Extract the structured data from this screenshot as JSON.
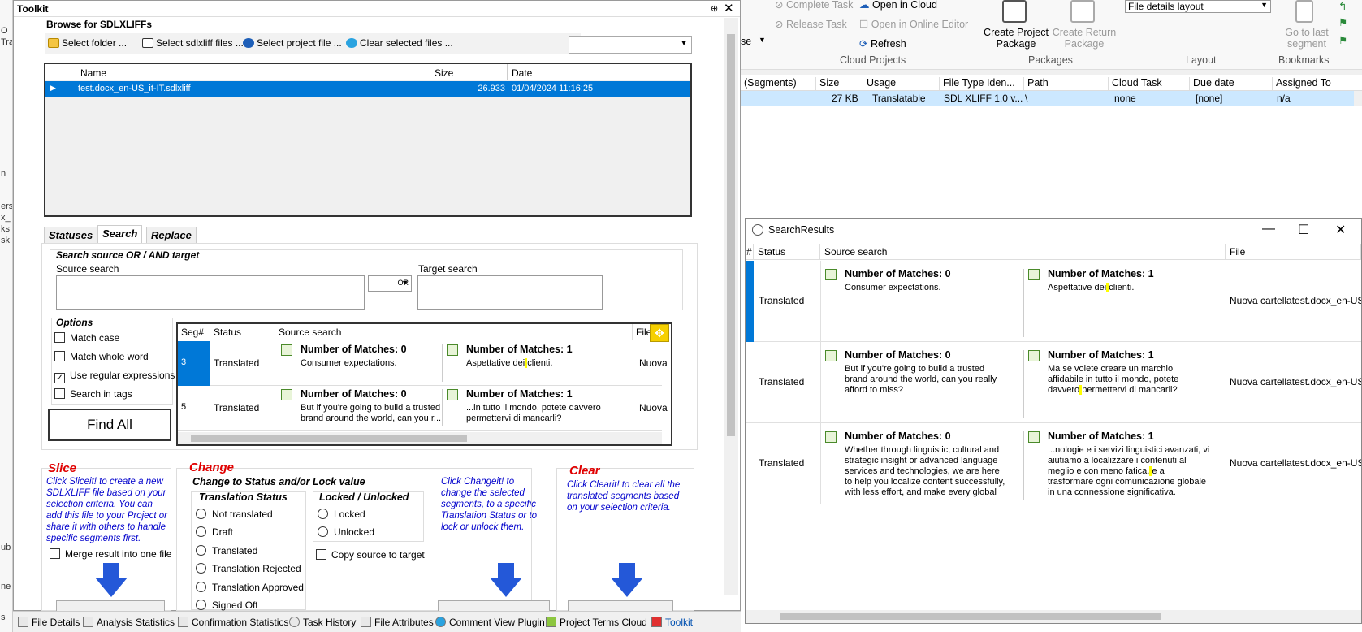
{
  "left_strip": [
    "O",
    "Tra",
    "n",
    "ers",
    "x_",
    "ks",
    "sk",
    "ub",
    "ne",
    "s"
  ],
  "toolkit": {
    "title": "Toolkit",
    "pin": "⊕",
    "close": "✕",
    "browse_label": "Browse for SDLXLIFFs",
    "buttons": {
      "select_folder": "Select folder ...",
      "select_sdlxliff": "Select sdlxliff files ...",
      "select_project": "Select project file ...",
      "clear_selected": "Clear selected files ..."
    },
    "file_grid": {
      "headers": [
        "Name",
        "Size",
        "Date"
      ],
      "row": {
        "name": "test.docx_en-US_it-IT.sdlxliff",
        "size": "26.933",
        "date": "01/04/2024 11:16:25"
      }
    },
    "tabs": [
      "Statuses",
      "Search",
      "Replace"
    ],
    "search": {
      "group_label": "Search source OR / AND target",
      "source_label": "Source search",
      "operator": "OR",
      "target_label": "Target search"
    },
    "options": {
      "label": "Options",
      "match_case": "Match case",
      "match_whole_word": "Match whole word",
      "use_regex": "Use regular expressions",
      "search_in_tags": "Search in tags",
      "checked_mark": "✓"
    },
    "find_all": "Find All",
    "results": {
      "headers": [
        "Seg#",
        "Status",
        "Source search",
        "File"
      ],
      "rows": [
        {
          "seg": "3",
          "status": "Translated",
          "src_title": "Number of Matches: 0",
          "src_text": "Consumer expectations.",
          "tgt_title": "Number of Matches: 1",
          "tgt_pre": "Aspettative dei",
          "tgt_hl": " ",
          "tgt_post": "clienti.",
          "file": "Nuova"
        },
        {
          "seg": "5",
          "status": "Translated",
          "src_title": "Number of Matches: 0",
          "src_text": "But if you're going to build a trusted brand around the world, can you r...",
          "tgt_title": "Number of Matches: 1",
          "tgt_pre": "...in tutto il mondo, potete davvero",
          "tgt_hl": " ",
          "tgt_post": "permettervi di mancarli?",
          "file": "Nuova"
        }
      ]
    },
    "slice": {
      "title": "Slice",
      "desc": "Click Sliceit! to create a new SDLXLIFF file based on your selection criteria. You can add this file to your Project or share it with others to handle specific segments first.",
      "merge": "Merge result into one file"
    },
    "change": {
      "title": "Change",
      "group_label": "Change to Status and/or Lock value",
      "translation_status_label": "Translation Status",
      "statuses": [
        "Not translated",
        "Draft",
        "Translated",
        "Translation Rejected",
        "Translation Approved",
        "Signed Off"
      ],
      "lock_label": "Locked / Unlocked",
      "locked": "Locked",
      "unlocked": "Unlocked",
      "copy_source": "Copy source to target",
      "desc": "Click Changeit! to change the selected segments, to a specific Translation Status or to lock or unlock them."
    },
    "clear": {
      "title": "Clear",
      "desc": "Click Clearit! to clear all the translated segments based on your selection criteria."
    }
  },
  "bottom_tabs": [
    "File Details",
    "Analysis Statistics",
    "Confirmation Statistics",
    "Task History",
    "File Attributes",
    "Comment View Plugin",
    "Project Terms Cloud",
    "Toolkit"
  ],
  "ribbon": {
    "se_label": "se",
    "complete_task": "Complete Task",
    "release_task": "Release Task",
    "open_in_cloud": "Open in Cloud",
    "open_in_online_editor": "Open in Online Editor",
    "refresh": "Refresh",
    "cloud_projects": "Cloud Projects",
    "create_project_package": [
      "Create Project",
      "Package"
    ],
    "create_return_package": [
      "Create Return",
      "Package"
    ],
    "packages": "Packages",
    "layout_value": "File details layout",
    "layout": "Layout",
    "go_to_last_segment": [
      "Go to last",
      "segment"
    ],
    "bookmarks": "Bookmarks"
  },
  "file_details": {
    "headers": [
      "(Segments)",
      "Size",
      "Usage",
      "File Type Iden...",
      "Path",
      "Cloud Task",
      "Due date",
      "Assigned To"
    ],
    "row": [
      "27 KB",
      "Translatable",
      "SDL XLIFF 1.0 v...",
      "\\",
      "none",
      "[none]",
      "n/a"
    ]
  },
  "search_results": {
    "title": "SearchResults",
    "minimize": "—",
    "maximize": "☐",
    "close": "✕",
    "headers": [
      "#",
      "Status",
      "Source search",
      "File"
    ],
    "rows": [
      {
        "status": "Translated",
        "src_title": "Number of Matches: 0",
        "src_text": "Consumer expectations.",
        "tgt_title": "Number of Matches: 1",
        "tgt_pre": "Aspettative dei",
        "tgt_hl": " ",
        "tgt_post": "clienti.",
        "file": "Nuova cartellatest.docx_en-US_i"
      },
      {
        "status": "Translated",
        "src_title": "Number of Matches: 0",
        "src_text": "But if you're going to build a trusted brand around the world, can you really afford to miss?",
        "tgt_title": "Number of Matches: 1",
        "tgt_pre": "Ma se volete creare un marchio affidabile in tutto il mondo, potete davvero",
        "tgt_hl": " ",
        "tgt_post": "permettervi di mancarli?",
        "file": "Nuova cartellatest.docx_en-US_i"
      },
      {
        "status": "Translated",
        "src_title": "Number of Matches: 0",
        "src_text": "Whether through linguistic, cultural and strategic insight or advanced language services and technologies, we are here to help you localize content successfully, with less effort, and make every global",
        "tgt_title": "Number of Matches: 1",
        "tgt_pre": "...nologie e i servizi linguistici avanzati, vi aiutiamo a localizzare i contenuti al meglio e con meno fatica,",
        "tgt_hl": " ",
        "tgt_post": "e a trasformare ogni comunicazione globale in una connessione significativa.",
        "file": "Nuova cartellatest.docx_en-US_i"
      }
    ]
  },
  "colors": {
    "accent": "#0078d7",
    "highlight": "#ffff00",
    "section_red": "#e00000",
    "hint_blue": "#0000cc"
  }
}
